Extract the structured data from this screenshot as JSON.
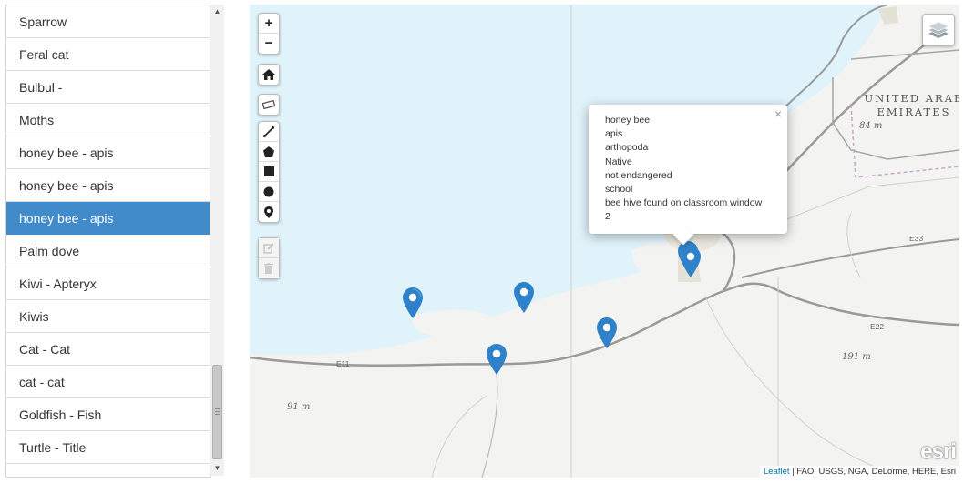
{
  "list": {
    "items": [
      {
        "label": "Sparrow"
      },
      {
        "label": "Feral cat"
      },
      {
        "label": "Bulbul -"
      },
      {
        "label": "Moths"
      },
      {
        "label": "honey bee - apis"
      },
      {
        "label": "honey bee - apis"
      },
      {
        "label": "honey bee - apis",
        "selected": true
      },
      {
        "label": "Palm dove"
      },
      {
        "label": "Kiwi - Apteryx"
      },
      {
        "label": "Kiwis"
      },
      {
        "label": "Cat - Cat"
      },
      {
        "label": "cat - cat"
      },
      {
        "label": "Goldfish - Fish"
      },
      {
        "label": "Turtle - Title"
      }
    ],
    "selected_color": "#428bca"
  },
  "map": {
    "controls": {
      "zoom_in": "+",
      "zoom_out": "−"
    },
    "labels": {
      "country": "UNITED ARAB EMIRATES",
      "country_line1": "UNITED ARAB",
      "country_line2": "EMIRATES",
      "elev_84": "84 m",
      "elev_191": "191 m",
      "elev_91": "91 m",
      "road_e11": "E11",
      "road_e22": "E22",
      "road_e33": "E33"
    },
    "popup": {
      "lines": [
        "honey bee",
        "apis",
        "arthopoda",
        "Native",
        "not endangered",
        "school",
        "bee hive found on classroom window",
        "2"
      ],
      "close": "×"
    },
    "attribution": {
      "leaflet": "Leaflet",
      "sources": " | FAO, USGS, NGA, DeLorme, HERE, Esri"
    },
    "logo": "esri",
    "water_color": "#e0f3fb",
    "land_color": "#f3f3f1",
    "marker_color": "#2f82c9"
  }
}
